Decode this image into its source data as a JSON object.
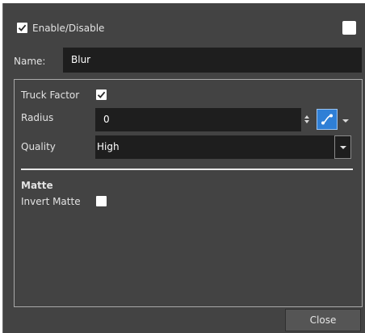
{
  "header": {
    "enable_label": "Enable/Disable",
    "enable_checked": true,
    "corner_checkbox_checked": false
  },
  "name_row": {
    "label": "Name:",
    "value": "Blur"
  },
  "settings": {
    "truck_factor_label": "Truck Factor",
    "truck_factor_checked": true,
    "radius_label": "Radius",
    "radius_value": "0",
    "quality_label": "Quality",
    "quality_value": "High"
  },
  "matte": {
    "section_title": "Matte",
    "invert_label": "Invert Matte",
    "invert_checked": false
  },
  "footer": {
    "close_label": "Close"
  },
  "colors": {
    "window_bg": "#434343",
    "field_bg": "#1e1e1e",
    "function_button_blue": "#2f7fd6"
  }
}
